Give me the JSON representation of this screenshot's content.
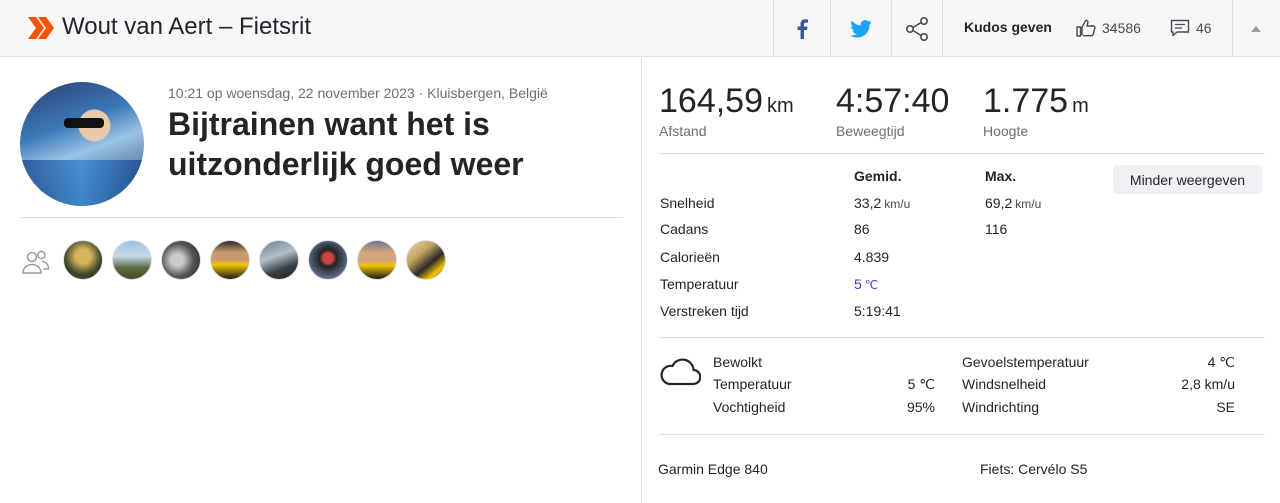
{
  "header": {
    "title": "Wout van Aert – Fietsrit",
    "kudos_label": "Kudos geven",
    "kudos_count": "34586",
    "comment_count": "46"
  },
  "activity": {
    "meta": "10:21 op woensdag, 22 november 2023 · Kluisbergen, België",
    "name": "Bijtrainen want het is uitzonderlijk goed weer",
    "athletes_count_shown": 8
  },
  "stats": {
    "distance": {
      "value": "164,59",
      "unit": "km",
      "label": "Afstand"
    },
    "moving_time": {
      "value": "4:57:40",
      "label": "Beweegtijd"
    },
    "elevation": {
      "value": "1.775",
      "unit": "m",
      "label": "Hoogte"
    }
  },
  "details": {
    "toggle_label": "Minder weergeven",
    "col_avg": "Gemid.",
    "col_max": "Max.",
    "rows": [
      {
        "label": "Snelheid",
        "avg": "33,2",
        "avg_unit": "km/u",
        "max": "69,2",
        "max_unit": "km/u"
      },
      {
        "label": "Cadans",
        "avg": "86",
        "avg_unit": "",
        "max": "116",
        "max_unit": ""
      },
      {
        "label": "Calorieën",
        "avg": "4.839",
        "avg_unit": "",
        "max": "",
        "max_unit": ""
      },
      {
        "label": "Temperatuur",
        "avg": "5",
        "avg_unit": "℃",
        "max": "",
        "max_unit": ""
      },
      {
        "label": "Verstreken tijd",
        "avg": "5:19:41",
        "avg_unit": "",
        "max": "",
        "max_unit": ""
      }
    ]
  },
  "weather": {
    "condition": "Bewolkt",
    "temp_label": "Temperatuur",
    "temp_value": "5 ℃",
    "humidity_label": "Vochtigheid",
    "humidity_value": "95%",
    "feels_label": "Gevoelstemperatuur",
    "feels_value": "4 ℃",
    "wind_speed_label": "Windsnelheid",
    "wind_speed_value": "2,8 km/u",
    "wind_dir_label": "Windrichting",
    "wind_dir_value": "SE"
  },
  "gear": {
    "device": "Garmin Edge 840",
    "bike": "Fiets: Cervélo S5"
  },
  "colors": {
    "brand": "#fc5200",
    "facebook": "#3b5998",
    "twitter": "#1da1f2",
    "temperature": "#3a3ac4"
  }
}
